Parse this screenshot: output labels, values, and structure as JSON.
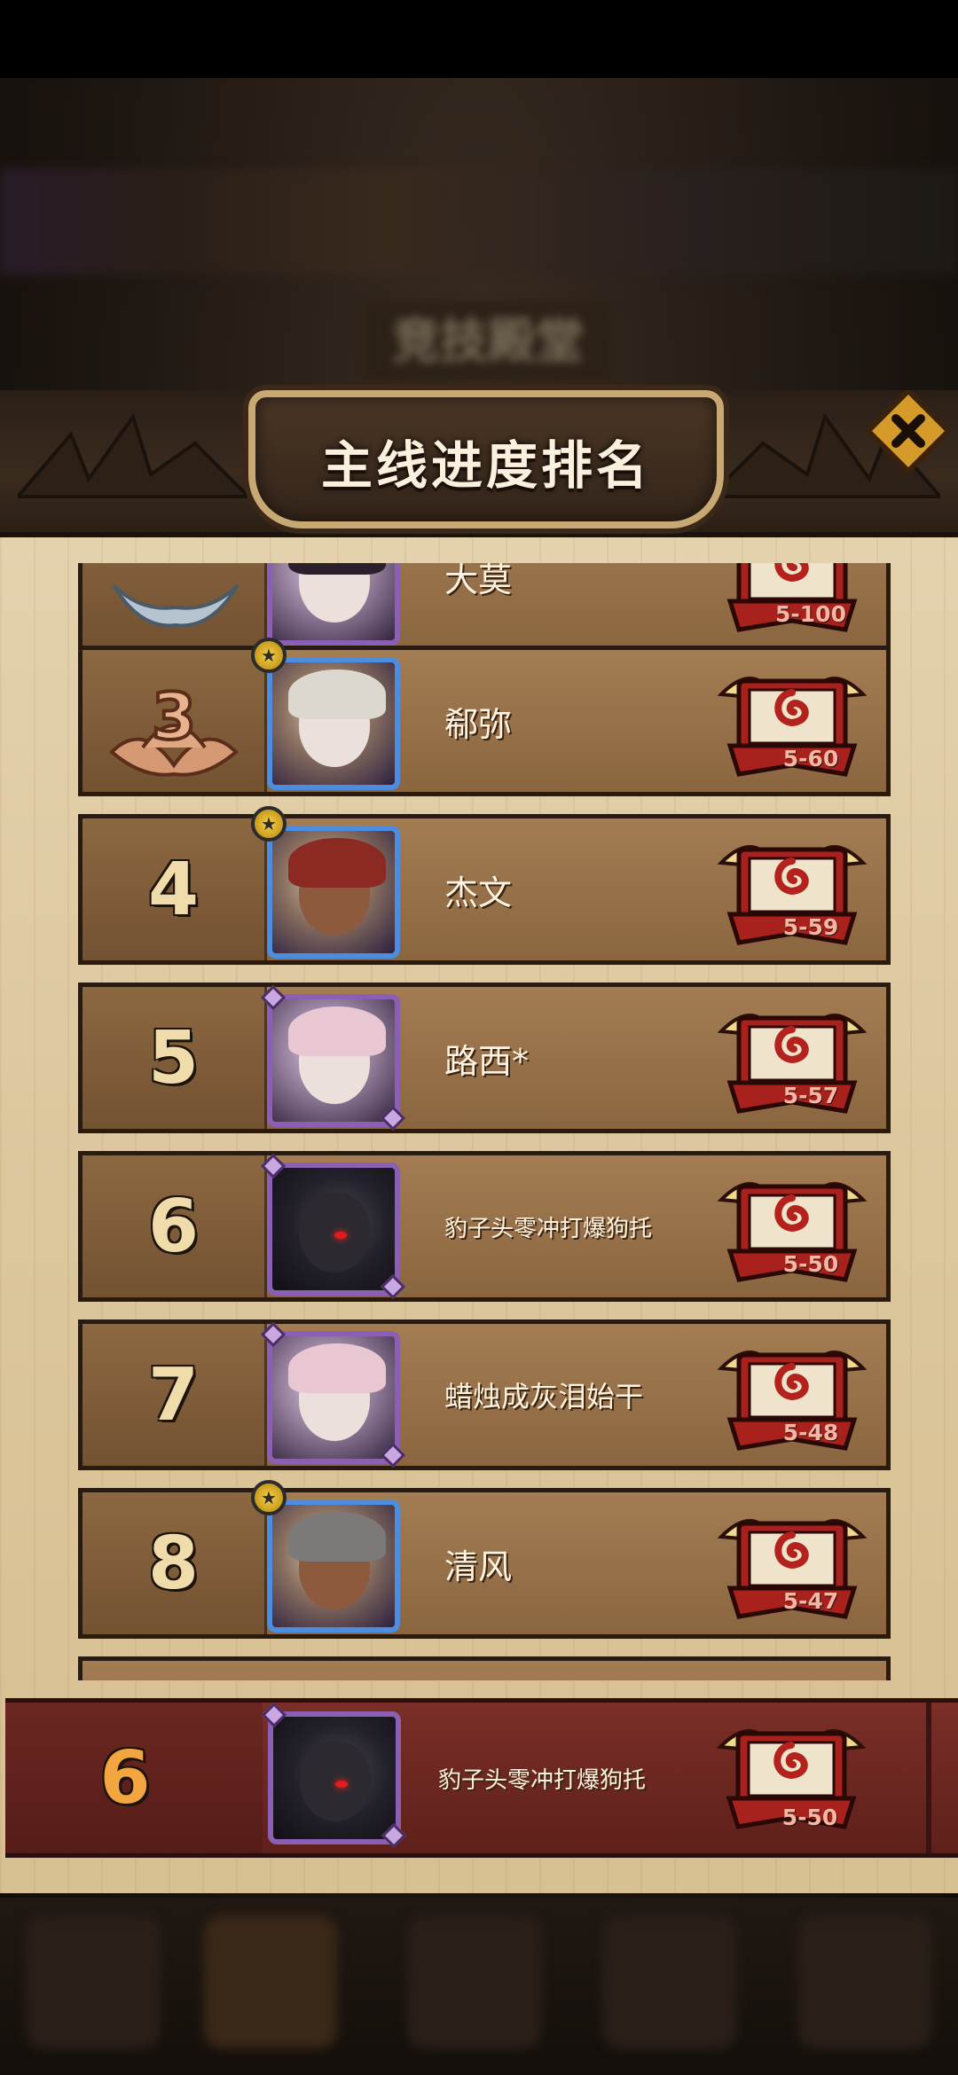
{
  "header": {
    "title": "主线进度排名",
    "close_icon": "close-x-icon"
  },
  "background": {
    "blurred_title": "竞技殿堂"
  },
  "rows": [
    {
      "rank": "",
      "rank_icon": "silver-rank-emblem-icon",
      "name": "大莫",
      "stage": "5-100"
    },
    {
      "rank": "3",
      "rank_icon": "bronze-rank-3-emblem-icon",
      "name": "郗弥",
      "stage": "5-60"
    },
    {
      "rank": "4",
      "name": "杰文",
      "stage": "5-59"
    },
    {
      "rank": "5",
      "name": "路西*",
      "stage": "5-57"
    },
    {
      "rank": "6",
      "name": "豹子头零冲打爆狗托",
      "stage": "5-50"
    },
    {
      "rank": "7",
      "name": "蜡烛成灰泪始干",
      "stage": "5-48"
    },
    {
      "rank": "8",
      "name": "清风",
      "stage": "5-47"
    }
  ],
  "my_rank": {
    "rank": "6",
    "name": "豹子头零冲打爆狗托",
    "stage": "5-50"
  },
  "colors": {
    "panel": "#dcc69c",
    "row": "#8a6640",
    "my_row": "#6b2721",
    "rank_text": "#f0dcaa",
    "my_rank_text": "#f3a640",
    "frame_blue": "#4c8de0",
    "frame_purple": "#8a5fb4"
  }
}
